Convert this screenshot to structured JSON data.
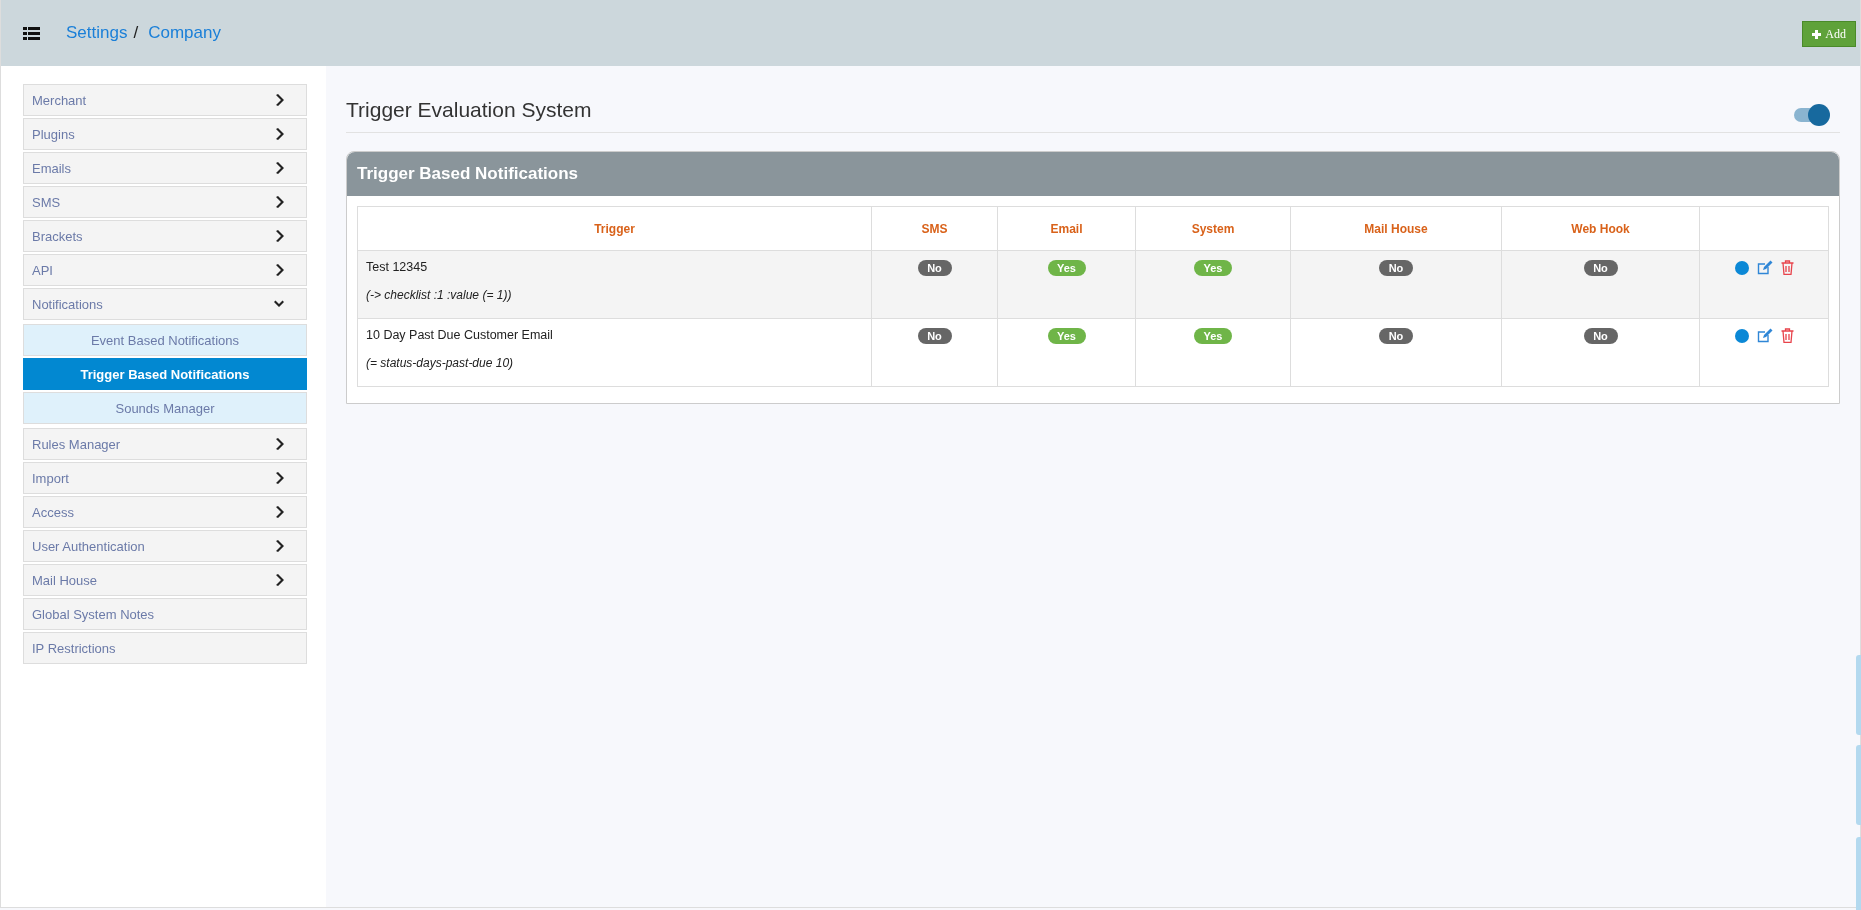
{
  "breadcrumb": {
    "items": [
      "Settings",
      "Company"
    ],
    "separator": "/"
  },
  "add_button": {
    "label": "Add"
  },
  "sidebar": {
    "items": [
      {
        "label": "Merchant",
        "kind": "group",
        "expanded": false
      },
      {
        "label": "Plugins",
        "kind": "group",
        "expanded": false
      },
      {
        "label": "Emails",
        "kind": "group",
        "expanded": false
      },
      {
        "label": "SMS",
        "kind": "group",
        "expanded": false
      },
      {
        "label": "Brackets",
        "kind": "group",
        "expanded": false
      },
      {
        "label": "API",
        "kind": "group",
        "expanded": false
      },
      {
        "label": "Notifications",
        "kind": "group",
        "expanded": true,
        "children": [
          {
            "label": "Event Based Notifications",
            "selected": false
          },
          {
            "label": "Trigger Based Notifications",
            "selected": true
          },
          {
            "label": "Sounds Manager",
            "selected": false
          }
        ]
      },
      {
        "label": "Rules Manager",
        "kind": "group",
        "expanded": false
      },
      {
        "label": "Import",
        "kind": "group",
        "expanded": false
      },
      {
        "label": "Access",
        "kind": "group",
        "expanded": false
      },
      {
        "label": "User Authentication",
        "kind": "group",
        "expanded": false
      },
      {
        "label": "Mail House",
        "kind": "group",
        "expanded": false
      },
      {
        "label": "Global System Notes",
        "kind": "link"
      },
      {
        "label": "IP Restrictions",
        "kind": "link"
      }
    ]
  },
  "section": {
    "title": "Trigger Evaluation System",
    "toggle": {
      "on": true
    }
  },
  "panel": {
    "title": "Trigger Based Notifications",
    "table": {
      "columns": [
        "Trigger",
        "SMS",
        "Email",
        "System",
        "Mail House",
        "Web Hook"
      ],
      "rows": [
        {
          "name": "Test 12345",
          "expression": "(-> checklist :1 :value (= 1))",
          "flags": [
            {
              "text": "No",
              "on": false
            },
            {
              "text": "Yes",
              "on": true
            },
            {
              "text": "Yes",
              "on": true
            },
            {
              "text": "No",
              "on": false
            },
            {
              "text": "No",
              "on": false
            }
          ]
        },
        {
          "name": "10 Day Past Due Customer Email",
          "expression": "(= status-days-past-due 10)",
          "flags": [
            {
              "text": "No",
              "on": false
            },
            {
              "text": "Yes",
              "on": true
            },
            {
              "text": "Yes",
              "on": true
            },
            {
              "text": "No",
              "on": false
            },
            {
              "text": "No",
              "on": false
            }
          ]
        }
      ]
    }
  }
}
